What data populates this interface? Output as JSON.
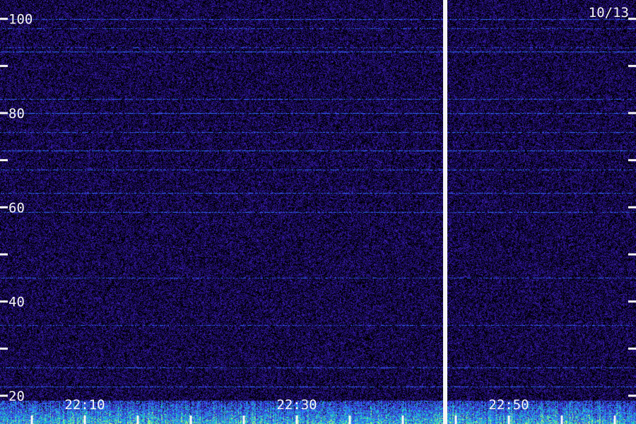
{
  "chart_data": {
    "type": "heatmap",
    "date_label": "10/13",
    "y_ticks": [
      100,
      80,
      60,
      40,
      20
    ],
    "ylim": [
      14,
      104
    ],
    "x_ticks": [
      "22:10",
      "22:30",
      "22:50"
    ],
    "x_tick_times_min": [
      10,
      30,
      50
    ],
    "xlim_min": [
      2,
      62
    ],
    "minor_tick_interval_min": 5,
    "gap_time_min": 44,
    "colors": {
      "background": "#000000",
      "noise_low": "#1b0a63",
      "noise_high": "#3a1fb0",
      "band": "#2f6cff",
      "strong": "#20d0c0",
      "peak": "#b8ff70",
      "text": "#f4f4f4"
    },
    "features": {
      "low_frequency_band_top": 19,
      "horizontal_lines": [
        100,
        98,
        94,
        93,
        83,
        80,
        76,
        72,
        68,
        63,
        59,
        45,
        35,
        26,
        22
      ]
    }
  }
}
